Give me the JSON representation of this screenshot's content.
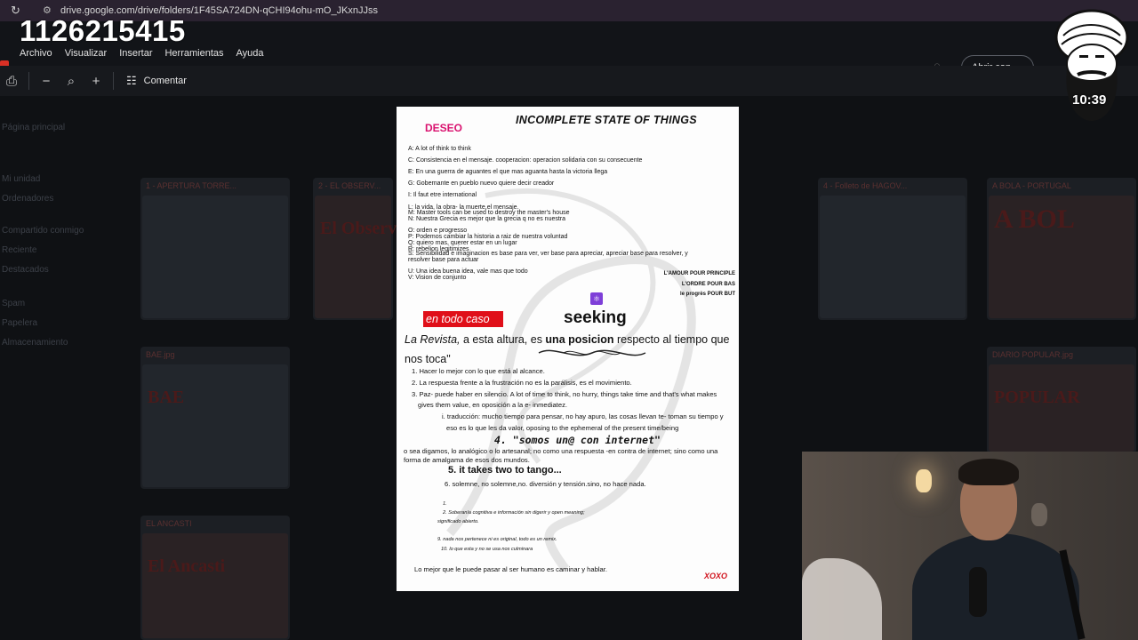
{
  "browser": {
    "url": "drive.google.com/drive/folders/1F45SA724DN-qCHI94ohu-mO_JKxnJJss"
  },
  "overlay": {
    "number": "1126215415",
    "timer": "10:39"
  },
  "app": {
    "menu": [
      "Archivo",
      "Visualizar",
      "Insertar",
      "Herramientas",
      "Ayuda"
    ],
    "open_with": "Abrir con",
    "comment": "Comentar"
  },
  "document": {
    "deseo": "DESEO",
    "title": "INCOMPLETE STATE OF THINGS",
    "list_lines": [
      "A: A  lot of think to think",
      "C: Consistencia en el mensaje. cooperacion: operacion solidaria con su consecuente",
      "E: En una guerra de aguantes el que mas aguanta hasta la victoria llega",
      "G: Gobernante en pueblo nuevo quiere decir creador",
      "I: Il faut etre international",
      "L: la vida, la obra- la muerte,el mensaje.",
      "M: Master tools can be used to destroy the master's house",
      "N: Nuestra Grecia es mejor que la grecia q no es nuestra",
      "O: orden e progresso",
      "P: Podemos cambiar la historia a raiz de nuestra voluntad",
      "Q: quiero mas, querer estar en un lugar",
      "R: rebelion legitimizes",
      "S: Sensibilidad e imaginacion es base para ver, ver base para apreciar, apreciar base para resolver, y",
      "resolver base para actuar",
      "U: Una idea buena idea, vale mas que todo",
      "V: Vision de conjunto"
    ],
    "amour": [
      "L'AMOUR POUR PRINCIPLE",
      "L'ORDRE POUR BAS",
      "le progrès POUR BUT"
    ],
    "en_todo_caso": "en todo caso",
    "seeking": "seeking",
    "revista_italic": "La Revista,",
    "revista_mid": " a esta altura, es ",
    "revista_bold": "una posicion",
    "revista_end": " respecto al tiempo que nos toca\"",
    "items": [
      "1. Hacer lo mejor con lo que está al alcance.",
      "2. La respuesta frente a la frustración no es la parálisis, es el movimiento.",
      "3. Paz- puede haber en silencio. A lot of time to think, no hurry, things take time and that's what makes",
      "gives them value, en oposición a la e- inmediatez.",
      "i. traducción: mucho tiempo para pensar, no hay apuro, las cosas llevan te- toman su tiempo y",
      "eso es lo que les da valor, oposing to the ephemeral of the present time/being"
    ],
    "somos": "4. \"somos un@ con internet\"",
    "o_sea": "o sea digamos, lo analógico o lo artesanal; no como una respuesta -en contra de internet; sino como una",
    "forma": "forma de amalgama de esos dos mundos.",
    "tango": "5. it takes two to tango...",
    "solemne": "6. solemne, no solemne,no.  diversión y tensión.sino, no hace nada.",
    "small_lines": [
      "1.",
      "2. Soberanía cognitiva e información sin digerir y open meaning;",
      "significado abierto.",
      "9. nada nos pertenece ni es original, todo es un remix.",
      "10.  lo que esta y no se usa nos culminara"
    ],
    "lo_mejor": "Lo mejor que le puede pasar al ser humano es caminar y hablar.",
    "xoxo": "XOXO"
  },
  "drive_bg": {
    "sidebar": [
      "Página principal",
      "Mi unidad",
      "Ordenadores",
      "Compartido conmigo",
      "Reciente",
      "Destacados",
      "Spam",
      "Papelera",
      "Almacenamiento"
    ],
    "thumbs": [
      "1 - APERTURA TORRE...",
      "2 - EL OBSERV...",
      "4 - Folleto de HAGOV...",
      "A BOLA - PORTUGAL",
      "BAE.jpg",
      "DIARIO POPULAR.jpg",
      "EL ANCASTI"
    ],
    "thumb_big_texts": [
      "El Observ",
      "A BOL",
      "BAE",
      "El Ancasti",
      "POPULAR"
    ]
  }
}
